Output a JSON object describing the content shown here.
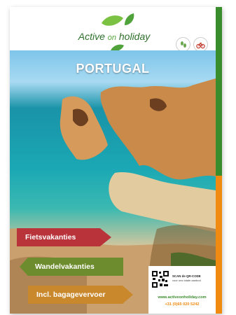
{
  "brand": {
    "word1": "Active",
    "word2": "on",
    "word3": "holiday"
  },
  "cover": {
    "title": "PORTUGAL"
  },
  "icons": {
    "badge_left": "walking-icon",
    "badge_right": "cycling-icon"
  },
  "signs": [
    {
      "label": "Fietsvakanties",
      "color": "#b8333a"
    },
    {
      "label": "Wandelvakanties",
      "color": "#6d8c2e"
    },
    {
      "label": "Incl. bagagevervoer",
      "color": "#c9882c"
    }
  ],
  "contact": {
    "scan_title": "SCAN de QR-CODE",
    "scan_subtitle": "voor ons totale aanbod",
    "website": "www.activeonholiday.com",
    "phone": "+31 (0)65 020 5242"
  },
  "colors": {
    "brand_green": "#3a8d2c",
    "accent_orange": "#f08a10"
  }
}
